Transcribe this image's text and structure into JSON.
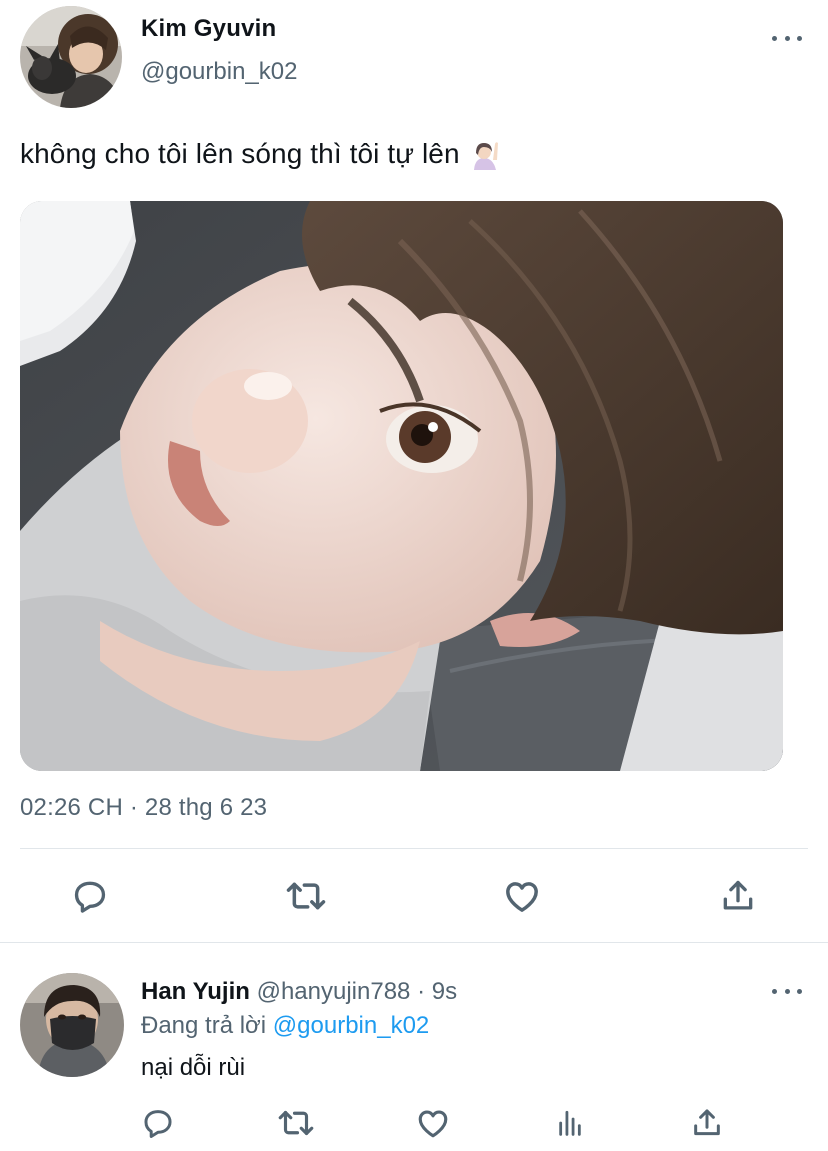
{
  "tweet": {
    "author_name": "Kim Gyuvin",
    "author_handle": "@gourbin_k02",
    "text": "không cho tôi lên sóng thì tôi tự lên",
    "emoji_icon": "person-raising-hand-emoji",
    "timestamp": "02:26 CH · 28 thg 6 23",
    "actions": [
      "reply-icon",
      "retweet-icon",
      "like-icon",
      "share-icon"
    ]
  },
  "reply": {
    "author_name": "Han Yujin",
    "author_handle": "@hanyujin788",
    "separator": "·",
    "time": "9s",
    "replying_prefix": "Đang trả lời",
    "replying_to": "@gourbin_k02",
    "text": "nại dỗi rùi",
    "actions": [
      "reply-icon",
      "retweet-icon",
      "like-icon",
      "views-icon",
      "share-icon"
    ]
  },
  "colors": {
    "text": "#0f1419",
    "secondary": "#536471",
    "link": "#1d9bf0",
    "divider": "#e1e6ea"
  }
}
